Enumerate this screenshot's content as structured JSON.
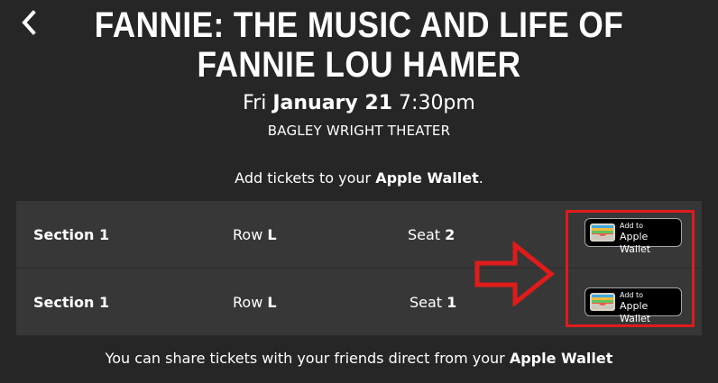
{
  "header": {
    "back_icon": "chevron-left-icon",
    "title": "FANNIE: THE MUSIC AND LIFE OF FANNIE LOU HAMER"
  },
  "event": {
    "day": "Fri",
    "date": "January 21",
    "time": "7:30pm",
    "venue": "BAGLEY WRIGHT THEATER"
  },
  "wallet_hint": {
    "prefix": "Add tickets to your",
    "emphasis": "Apple Wallet",
    "suffix": "."
  },
  "tickets": [
    {
      "section": "Section 1",
      "row_label": "Row",
      "row": "L",
      "seat_label": "Seat",
      "seat": "2"
    },
    {
      "section": "Section 1",
      "row_label": "Row",
      "row": "L",
      "seat_label": "Seat",
      "seat": "1"
    }
  ],
  "wallet_button": {
    "line1": "Add to",
    "line2": "Apple Wallet",
    "icon": "apple-wallet-icon"
  },
  "share_note": {
    "prefix": "You can share tickets with your friends direct from your",
    "emphasis": "Apple Wallet"
  },
  "annotation": {
    "highlight_color": "#e01b1b",
    "arrow_icon": "arrow-right-outline-icon"
  },
  "colors": {
    "background": "#262626",
    "row_background": "#373737",
    "text": "#ffffff"
  }
}
